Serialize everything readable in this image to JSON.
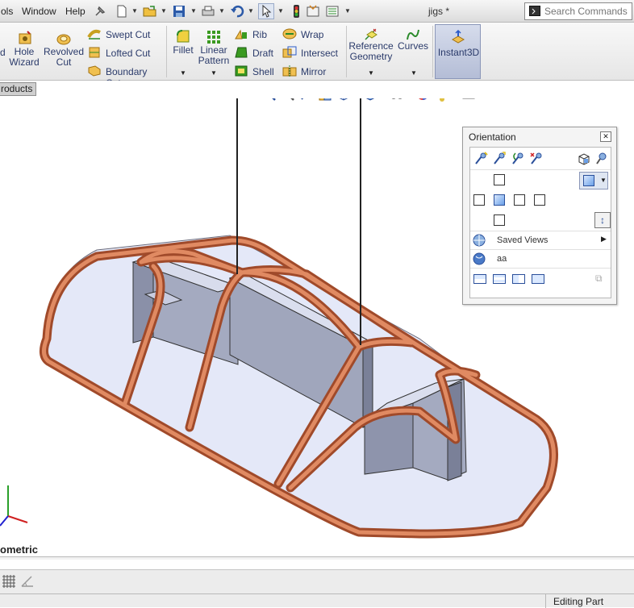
{
  "menu": {
    "items": [
      "ols",
      "Window",
      "Help"
    ]
  },
  "document": {
    "title": "jigs *"
  },
  "search": {
    "placeholder": "Search Commands"
  },
  "ribbon": {
    "hole_wizard": "Hole Wizard",
    "revolved_cut": "Revolved Cut",
    "swept_cut": "Swept Cut",
    "lofted_cut": "Lofted Cut",
    "boundary_cut": "Boundary Cut",
    "fillet": "Fillet",
    "linear_pattern": "Linear Pattern",
    "rib": "Rib",
    "draft": "Draft",
    "shell": "Shell",
    "wrap": "Wrap",
    "intersect": "Intersect",
    "mirror": "Mirror",
    "reference_geometry": "Reference Geometry",
    "curves": "Curves",
    "instant3d": "Instant3D"
  },
  "tabs": {
    "products": "roducts"
  },
  "orientation": {
    "title": "Orientation",
    "saved_views": "Saved Views",
    "view_name": "aa"
  },
  "viewport": {
    "view_label": "ometric"
  },
  "status": {
    "mode": "Editing Part"
  },
  "colors": {
    "tube": "#c8704c",
    "plate": "#e4e8f8",
    "upright": "#9aa0b8",
    "accent": "#2a3a6a"
  }
}
